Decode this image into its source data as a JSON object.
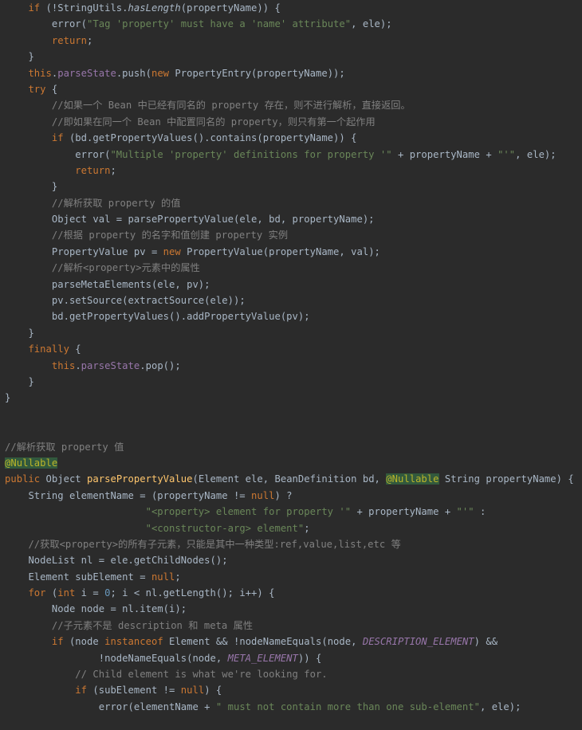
{
  "editor": {
    "language": "java",
    "theme": "darcula",
    "background_color": "#2b2b2b",
    "default_text_color": "#a9b7c6",
    "colors": {
      "keyword": "#cc7832",
      "string": "#6a8759",
      "comment": "#808080",
      "field": "#9876aa",
      "number": "#6897bb",
      "method_declaration": "#ffc66d",
      "annotation": "#bbb529",
      "static_constant": "#9876aa"
    },
    "lines": [
      {
        "n": 1,
        "indent": 1,
        "tokens": [
          {
            "t": "if ",
            "c": "kw"
          },
          {
            "t": "(!StringUtils.",
            "c": "plain"
          },
          {
            "t": "hasLength",
            "c": "ital"
          },
          {
            "t": "(propertyName)) {",
            "c": "plain"
          }
        ]
      },
      {
        "n": 2,
        "indent": 2,
        "tokens": [
          {
            "t": "error(",
            "c": "plain"
          },
          {
            "t": "\"Tag 'property' must have a 'name' attribute\"",
            "c": "str"
          },
          {
            "t": ", ele);",
            "c": "plain"
          }
        ]
      },
      {
        "n": 3,
        "indent": 2,
        "tokens": [
          {
            "t": "return",
            "c": "kw"
          },
          {
            "t": ";",
            "c": "plain"
          }
        ]
      },
      {
        "n": 4,
        "indent": 1,
        "tokens": [
          {
            "t": "}",
            "c": "plain"
          }
        ]
      },
      {
        "n": 5,
        "indent": 1,
        "tokens": [
          {
            "t": "this",
            "c": "kw"
          },
          {
            "t": ".",
            "c": "plain"
          },
          {
            "t": "parseState",
            "c": "fld"
          },
          {
            "t": ".push(",
            "c": "plain"
          },
          {
            "t": "new",
            "c": "kw"
          },
          {
            "t": " PropertyEntry(propertyName));",
            "c": "plain"
          }
        ]
      },
      {
        "n": 6,
        "indent": 1,
        "tokens": [
          {
            "t": "try",
            "c": "kw"
          },
          {
            "t": " {",
            "c": "plain"
          }
        ]
      },
      {
        "n": 7,
        "indent": 2,
        "tokens": [
          {
            "t": "//如果一个 Bean 中已经有同名的 property 存在，则不进行解析，直接返回。",
            "c": "cmt"
          }
        ]
      },
      {
        "n": 8,
        "indent": 2,
        "tokens": [
          {
            "t": "//即如果在同一个 Bean 中配置同名的 property，则只有第一个起作用",
            "c": "cmt"
          }
        ]
      },
      {
        "n": 9,
        "indent": 2,
        "tokens": [
          {
            "t": "if ",
            "c": "kw"
          },
          {
            "t": "(bd.getPropertyValues().contains(propertyName)) {",
            "c": "plain"
          }
        ]
      },
      {
        "n": 10,
        "indent": 3,
        "tokens": [
          {
            "t": "error(",
            "c": "plain"
          },
          {
            "t": "\"Multiple 'property' definitions for property '\"",
            "c": "str"
          },
          {
            "t": " + propertyName + ",
            "c": "plain"
          },
          {
            "t": "\"'\"",
            "c": "str"
          },
          {
            "t": ", ele);",
            "c": "plain"
          }
        ]
      },
      {
        "n": 11,
        "indent": 3,
        "tokens": [
          {
            "t": "return",
            "c": "kw"
          },
          {
            "t": ";",
            "c": "plain"
          }
        ]
      },
      {
        "n": 12,
        "indent": 2,
        "tokens": [
          {
            "t": "}",
            "c": "plain"
          }
        ]
      },
      {
        "n": 13,
        "indent": 2,
        "tokens": [
          {
            "t": "//解析获取 property 的值",
            "c": "cmt"
          }
        ]
      },
      {
        "n": 14,
        "indent": 2,
        "tokens": [
          {
            "t": "Object val = parsePropertyValue(ele, bd, propertyName);",
            "c": "plain"
          }
        ]
      },
      {
        "n": 15,
        "indent": 2,
        "tokens": [
          {
            "t": "//根据 property 的名字和值创建 property 实例",
            "c": "cmt"
          }
        ]
      },
      {
        "n": 16,
        "indent": 2,
        "tokens": [
          {
            "t": "PropertyValue pv = ",
            "c": "plain"
          },
          {
            "t": "new",
            "c": "kw"
          },
          {
            "t": " PropertyValue(propertyName, val);",
            "c": "plain"
          }
        ]
      },
      {
        "n": 17,
        "indent": 2,
        "tokens": [
          {
            "t": "//解析<property>元素中的属性",
            "c": "cmt"
          }
        ]
      },
      {
        "n": 18,
        "indent": 2,
        "tokens": [
          {
            "t": "parseMetaElements(ele, pv);",
            "c": "plain"
          }
        ]
      },
      {
        "n": 19,
        "indent": 2,
        "tokens": [
          {
            "t": "pv.setSource(extractSource(ele));",
            "c": "plain"
          }
        ]
      },
      {
        "n": 20,
        "indent": 2,
        "tokens": [
          {
            "t": "bd.getPropertyValues().addPropertyValue(pv);",
            "c": "plain"
          }
        ]
      },
      {
        "n": 21,
        "indent": 1,
        "tokens": [
          {
            "t": "}",
            "c": "plain"
          }
        ]
      },
      {
        "n": 22,
        "indent": 1,
        "tokens": [
          {
            "t": "finally",
            "c": "kw"
          },
          {
            "t": " {",
            "c": "plain"
          }
        ]
      },
      {
        "n": 23,
        "indent": 2,
        "tokens": [
          {
            "t": "this",
            "c": "kw"
          },
          {
            "t": ".",
            "c": "plain"
          },
          {
            "t": "parseState",
            "c": "fld"
          },
          {
            "t": ".pop();",
            "c": "plain"
          }
        ]
      },
      {
        "n": 24,
        "indent": 1,
        "tokens": [
          {
            "t": "}",
            "c": "plain"
          }
        ]
      },
      {
        "n": 25,
        "indent": 0,
        "tokens": [
          {
            "t": "}",
            "c": "plain"
          }
        ]
      },
      {
        "n": 26,
        "indent": 0,
        "tokens": []
      },
      {
        "n": 27,
        "indent": 0,
        "tokens": []
      },
      {
        "n": 28,
        "indent": 0,
        "tokens": [
          {
            "t": "//解析获取 property 值",
            "c": "cmt"
          }
        ]
      },
      {
        "n": 29,
        "indent": 0,
        "tokens": [
          {
            "t": "@Nullable",
            "c": "annoHl"
          }
        ]
      },
      {
        "n": 30,
        "indent": 0,
        "tokens": [
          {
            "t": "public",
            "c": "kw"
          },
          {
            "t": " Object ",
            "c": "plain"
          },
          {
            "t": "parsePropertyValue",
            "c": "mdecl"
          },
          {
            "t": "(Element ele, BeanDefinition bd, ",
            "c": "plain"
          },
          {
            "t": "@Nullable",
            "c": "annoHl"
          },
          {
            "t": " String propertyName) {",
            "c": "plain"
          }
        ]
      },
      {
        "n": 31,
        "indent": 1,
        "tokens": [
          {
            "t": "String elementName = (propertyName != ",
            "c": "plain"
          },
          {
            "t": "null",
            "c": "kw"
          },
          {
            "t": ") ?",
            "c": "plain"
          }
        ]
      },
      {
        "n": 32,
        "indent": 5,
        "tokens": [
          {
            "t": "    ",
            "c": "plain"
          },
          {
            "t": "\"<property> element for property '\"",
            "c": "str"
          },
          {
            "t": " + propertyName + ",
            "c": "plain"
          },
          {
            "t": "\"'\"",
            "c": "str"
          },
          {
            "t": " :",
            "c": "plain"
          }
        ]
      },
      {
        "n": 33,
        "indent": 5,
        "tokens": [
          {
            "t": "    ",
            "c": "plain"
          },
          {
            "t": "\"<constructor-arg> element\"",
            "c": "str"
          },
          {
            "t": ";",
            "c": "plain"
          }
        ]
      },
      {
        "n": 34,
        "indent": 1,
        "tokens": [
          {
            "t": "//获取<property>的所有子元素，只能是其中一种类型:ref,value,list,etc 等",
            "c": "cmt"
          }
        ]
      },
      {
        "n": 35,
        "indent": 1,
        "tokens": [
          {
            "t": "NodeList nl = ele.getChildNodes();",
            "c": "plain"
          }
        ]
      },
      {
        "n": 36,
        "indent": 1,
        "tokens": [
          {
            "t": "Element subElement = ",
            "c": "plain"
          },
          {
            "t": "null",
            "c": "kw"
          },
          {
            "t": ";",
            "c": "plain"
          }
        ]
      },
      {
        "n": 37,
        "indent": 1,
        "tokens": [
          {
            "t": "for ",
            "c": "kw"
          },
          {
            "t": "(",
            "c": "plain"
          },
          {
            "t": "int",
            "c": "kw"
          },
          {
            "t": " i = ",
            "c": "plain"
          },
          {
            "t": "0",
            "c": "num"
          },
          {
            "t": "; i < nl.getLength(); i++) {",
            "c": "plain"
          }
        ]
      },
      {
        "n": 38,
        "indent": 2,
        "tokens": [
          {
            "t": "Node node = nl.item(i);",
            "c": "plain"
          }
        ]
      },
      {
        "n": 39,
        "indent": 2,
        "tokens": [
          {
            "t": "//子元素不是 description 和 meta 属性",
            "c": "cmt"
          }
        ]
      },
      {
        "n": 40,
        "indent": 2,
        "tokens": [
          {
            "t": "if ",
            "c": "kw"
          },
          {
            "t": "(node ",
            "c": "plain"
          },
          {
            "t": "instanceof",
            "c": "kw"
          },
          {
            "t": " Element && !nodeNameEquals(node, ",
            "c": "plain"
          },
          {
            "t": "DESCRIPTION_ELEMENT",
            "c": "const"
          },
          {
            "t": ") &&",
            "c": "plain"
          }
        ]
      },
      {
        "n": 41,
        "indent": 4,
        "tokens": [
          {
            "t": "!nodeNameEquals(node, ",
            "c": "plain"
          },
          {
            "t": "META_ELEMENT",
            "c": "const"
          },
          {
            "t": ")) {",
            "c": "plain"
          }
        ]
      },
      {
        "n": 42,
        "indent": 3,
        "tokens": [
          {
            "t": "// Child element is what we're looking for.",
            "c": "cmt"
          }
        ]
      },
      {
        "n": 43,
        "indent": 3,
        "tokens": [
          {
            "t": "if ",
            "c": "kw"
          },
          {
            "t": "(subElement != ",
            "c": "plain"
          },
          {
            "t": "null",
            "c": "kw"
          },
          {
            "t": ") {",
            "c": "plain"
          }
        ]
      },
      {
        "n": 44,
        "indent": 4,
        "tokens": [
          {
            "t": "error(elementName + ",
            "c": "plain"
          },
          {
            "t": "\" must not contain more than one sub-element\"",
            "c": "str"
          },
          {
            "t": ", ele);",
            "c": "plain"
          }
        ]
      }
    ]
  }
}
